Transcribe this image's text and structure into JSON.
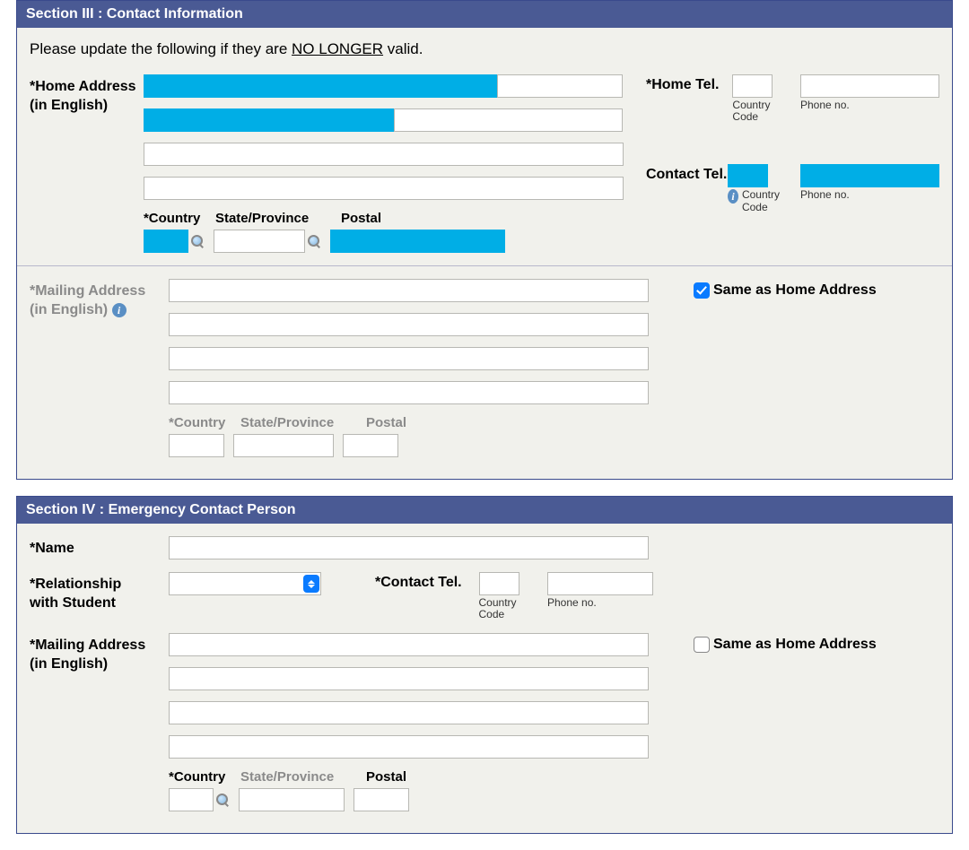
{
  "section3": {
    "title": "Section III : Contact Information",
    "instruction_pre": "Please update the following if they are ",
    "instruction_underline": "NO LONGER",
    "instruction_post": " valid.",
    "home_address_label_l1": "*Home Address",
    "home_address_label_l2": "(in English)",
    "home_tel_label": "*Home Tel.",
    "contact_tel_label": "Contact Tel.",
    "country_code_label": "Country Code",
    "phone_no_label": "Phone no.",
    "country_label": "*Country",
    "state_label": "State/Province",
    "postal_label": "Postal",
    "mailing_address_label_l1": "*Mailing Address",
    "mailing_address_label_l2": "(in English)",
    "same_as_home_label": "Same as Home Address",
    "same_as_home_checked": true
  },
  "section4": {
    "title": "Section IV : Emergency Contact Person",
    "name_label": "*Name",
    "relationship_label_l1": "*Relationship",
    "relationship_label_l2": "with Student",
    "contact_tel_label": "*Contact Tel.",
    "country_code_label": "Country Code",
    "phone_no_label": "Phone no.",
    "mailing_address_label_l1": "*Mailing Address",
    "mailing_address_label_l2": "(in English)",
    "same_as_home_label": "Same as Home Address",
    "same_as_home_checked": false,
    "country_label": "*Country",
    "state_label": "State/Province",
    "postal_label": "Postal"
  }
}
